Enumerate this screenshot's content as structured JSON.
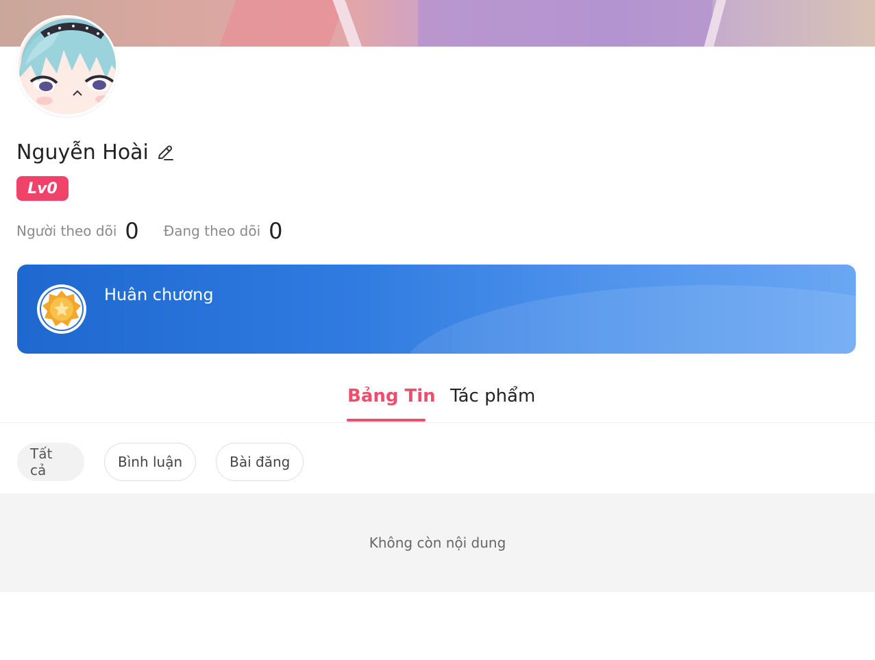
{
  "profile": {
    "username": "Nguyễn Hoài",
    "level": "Lv0"
  },
  "stats": {
    "followers_label": "Người theo dõi",
    "followers_value": "0",
    "following_label": "Đang theo dõi",
    "following_value": "0"
  },
  "medal_card": {
    "title": "Huân chương"
  },
  "tabs": [
    {
      "label": "Bảng Tin",
      "active": true
    },
    {
      "label": "Tác phẩm",
      "active": false
    }
  ],
  "filters": [
    {
      "label": "Tất cả",
      "selected": true
    },
    {
      "label": "Bình luận",
      "selected": false
    },
    {
      "label": "Bài đăng",
      "selected": false
    }
  ],
  "feed": {
    "empty_message": "Không còn nội dung"
  },
  "colors": {
    "accent_pink": "#ee4d6b",
    "level_badge": "#f0436a",
    "medal_card_start": "#1e68cf",
    "medal_card_end": "#6aa7f3"
  },
  "icons": {
    "edit": "pencil-icon",
    "medal": "medal-icon"
  }
}
